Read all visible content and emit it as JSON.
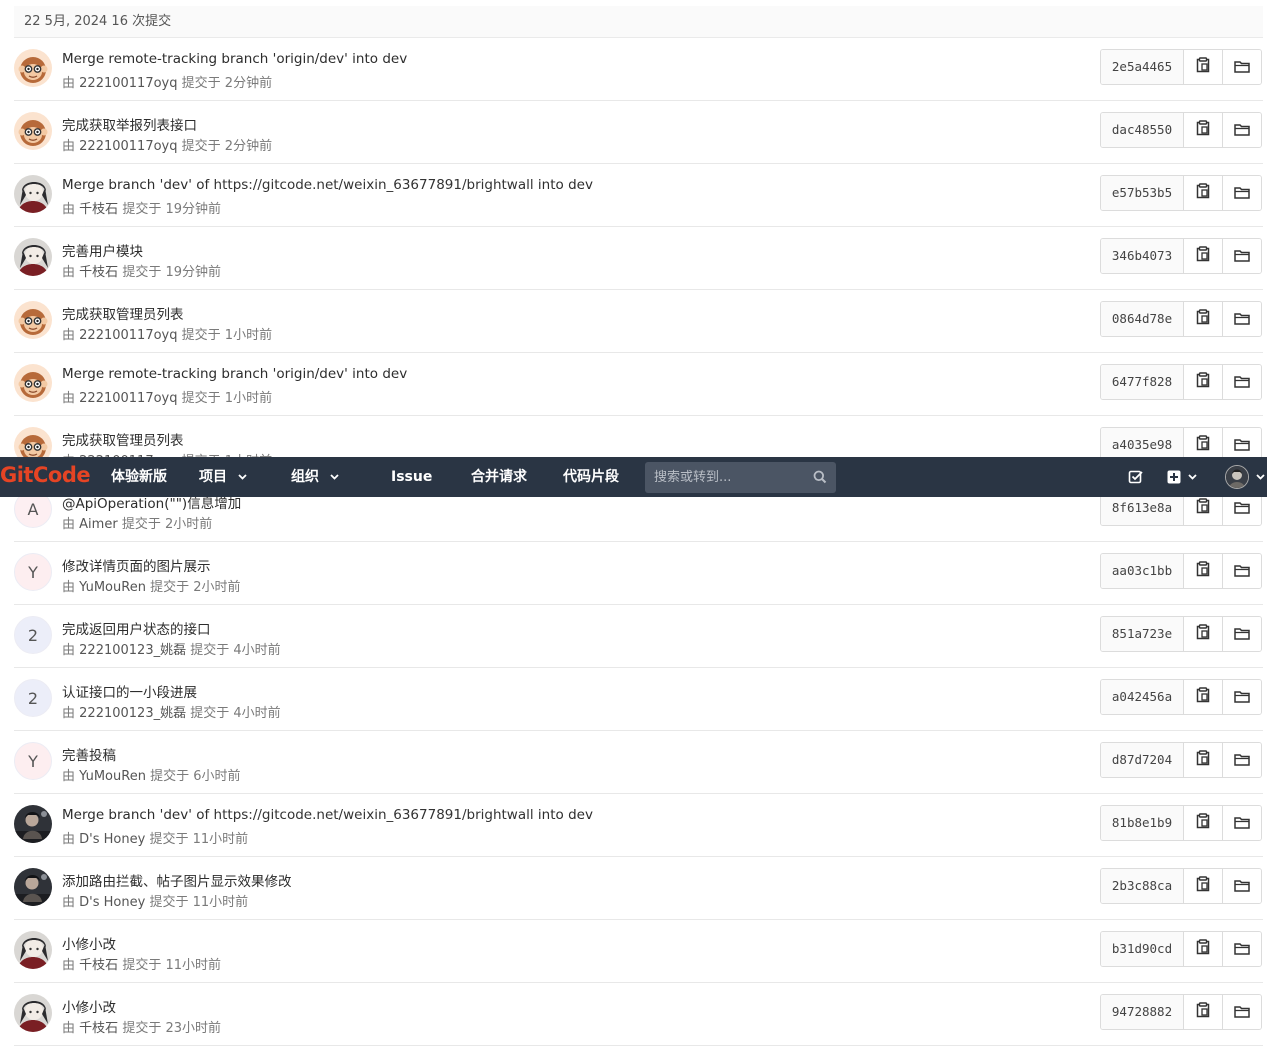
{
  "day_header": "22 5月, 2024 16 次提交",
  "by_label": "由",
  "commit_verb": "提交于",
  "commits": [
    {
      "title": "Merge remote-tracking branch 'origin/dev' into dev",
      "author": "222100117oyq",
      "time": "2分钟前",
      "sha": "2e5a4465",
      "avatar": "monkey"
    },
    {
      "title": "完成获取举报列表接口",
      "author": "222100117oyq",
      "time": "2分钟前",
      "sha": "dac48550",
      "avatar": "monkey"
    },
    {
      "title_prefix": "Merge branch 'dev' of ",
      "title_link": "https://gitcode.net/weixin_63677891/brightwall",
      "title_suffix": " into dev",
      "author": "千枝石",
      "time": "19分钟前",
      "sha": "e57b53b5",
      "avatar": "anime"
    },
    {
      "title": "完善用户模块",
      "author": "千枝石",
      "time": "19分钟前",
      "sha": "346b4073",
      "avatar": "anime"
    },
    {
      "title": "完成获取管理员列表",
      "author": "222100117oyq",
      "time": "1小时前",
      "sha": "0864d78e",
      "avatar": "monkey"
    },
    {
      "title": "Merge remote-tracking branch 'origin/dev' into dev",
      "author": "222100117oyq",
      "time": "1小时前",
      "sha": "6477f828",
      "avatar": "monkey"
    },
    {
      "title": "完成获取管理员列表",
      "author": "222100117oyq",
      "time": "1小时前",
      "sha": "a4035e98",
      "avatar": "monkey"
    },
    {
      "title": "@ApiOperation(\"\")信息增加",
      "author": "Aimer",
      "time": "2小时前",
      "sha": "8f613e8a",
      "avatar": "letter",
      "letter": "A"
    },
    {
      "title": "修改详情页面的图片展示",
      "author": "YuMouRen",
      "time": "2小时前",
      "sha": "aa03c1bb",
      "avatar": "letter",
      "letter": "Y"
    },
    {
      "title": "完成返回用户状态的接口",
      "author": "222100123_姚磊",
      "time": "4小时前",
      "sha": "851a723e",
      "avatar": "letter",
      "letter": "2"
    },
    {
      "title": "认证接口的一小段进展",
      "author": "222100123_姚磊",
      "time": "4小时前",
      "sha": "a042456a",
      "avatar": "letter",
      "letter": "2"
    },
    {
      "title": "完善投稿",
      "author": "YuMouRen",
      "time": "6小时前",
      "sha": "d87d7204",
      "avatar": "letter",
      "letter": "Y"
    },
    {
      "title_prefix": "Merge branch 'dev' of ",
      "title_link": "https://gitcode.net/weixin_63677891/brightwall",
      "title_suffix": " into dev",
      "author": "D's Honey",
      "time": "11小时前",
      "sha": "81b8e1b9",
      "avatar": "dark"
    },
    {
      "title": "添加路由拦截、帖子图片显示效果修改",
      "author": "D's Honey",
      "time": "11小时前",
      "sha": "2b3c88ca",
      "avatar": "dark"
    },
    {
      "title": "小修小改",
      "author": "千枝石",
      "time": "11小时前",
      "sha": "b31d90cd",
      "avatar": "anime"
    },
    {
      "title": "小修小改",
      "author": "千枝石",
      "time": "23小时前",
      "sha": "94728882",
      "avatar": "anime"
    }
  ],
  "navbar": {
    "brand": "GitCode",
    "items": [
      {
        "label": "体验新版",
        "caret": false
      },
      {
        "label": "项目",
        "caret": true
      },
      {
        "label": "组织",
        "caret": true
      },
      {
        "label": "Issue",
        "caret": false
      },
      {
        "label": "合并请求",
        "caret": false
      },
      {
        "label": "代码片段",
        "caret": false
      }
    ],
    "search_placeholder": "搜索或转到...",
    "icons": [
      "todo-icon",
      "create-new-icon",
      "user-avatar"
    ]
  },
  "colors": {
    "navbar_bg": "#2a3544",
    "brand": "#e64424",
    "search_bg": "#4b5564"
  }
}
